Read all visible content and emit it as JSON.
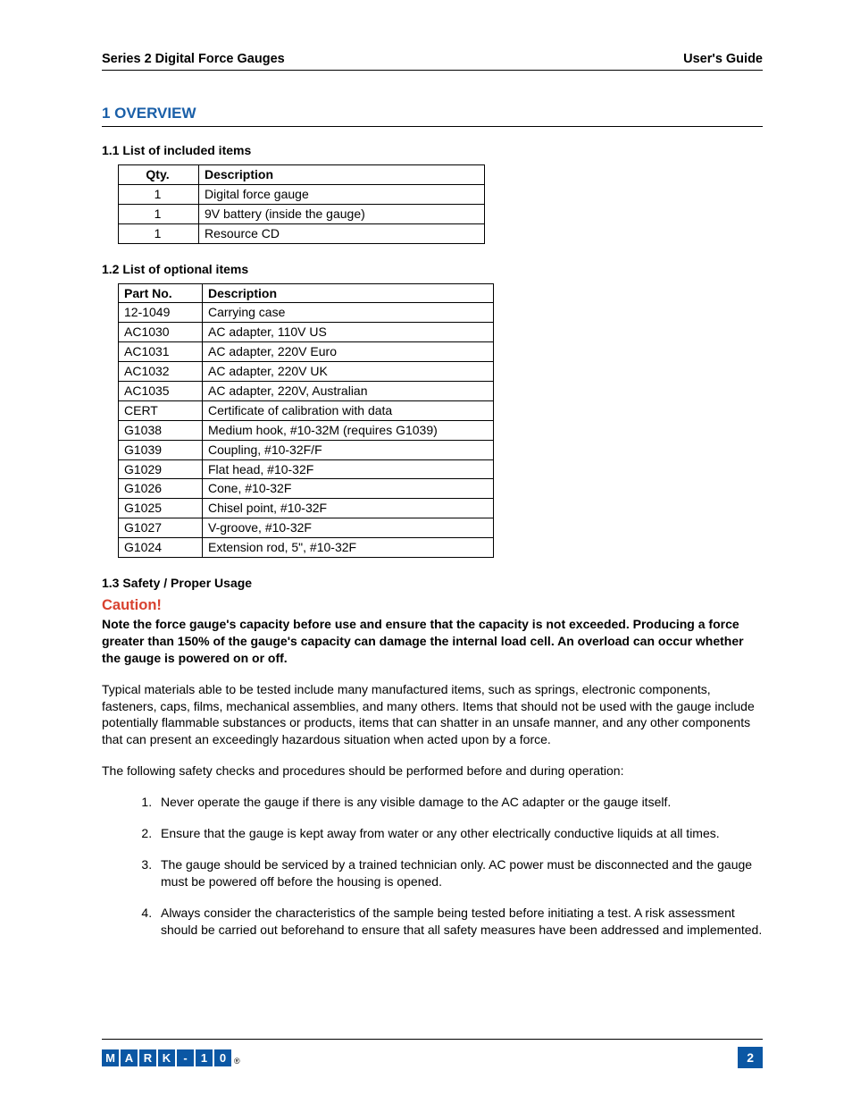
{
  "header": {
    "left": "Series 2 Digital Force Gauges",
    "right": "User's Guide"
  },
  "section": {
    "number_title": "1   OVERVIEW"
  },
  "sub11": {
    "heading": "1.1  List of included items",
    "col1": "Qty.",
    "col2": "Description",
    "rows": [
      {
        "qty": "1",
        "desc": "Digital force gauge"
      },
      {
        "qty": "1",
        "desc": "9V battery (inside the gauge)"
      },
      {
        "qty": "1",
        "desc": "Resource CD"
      }
    ]
  },
  "sub12": {
    "heading": "1.2  List of optional items",
    "col1": "Part No.",
    "col2": "Description",
    "rows": [
      {
        "part": "12-1049",
        "desc": "Carrying case"
      },
      {
        "part": "AC1030",
        "desc": "AC adapter, 110V US"
      },
      {
        "part": "AC1031",
        "desc": "AC adapter, 220V Euro"
      },
      {
        "part": "AC1032",
        "desc": "AC adapter, 220V UK"
      },
      {
        "part": "AC1035",
        "desc": "AC adapter, 220V, Australian"
      },
      {
        "part": "CERT",
        "desc": "Certificate of calibration with data"
      },
      {
        "part": "G1038",
        "desc": "Medium hook, #10-32M (requires G1039)"
      },
      {
        "part": "G1039",
        "desc": "Coupling, #10-32F/F"
      },
      {
        "part": "G1029",
        "desc": "Flat head, #10-32F"
      },
      {
        "part": "G1026",
        "desc": "Cone, #10-32F"
      },
      {
        "part": "G1025",
        "desc": "Chisel point, #10-32F"
      },
      {
        "part": "G1027",
        "desc": "V-groove, #10-32F"
      },
      {
        "part": "G1024",
        "desc": "Extension rod, 5\", #10-32F"
      }
    ]
  },
  "sub13": {
    "heading": "1.3 Safety / Proper Usage",
    "caution": "Caution!",
    "bold_note": "Note the force gauge's capacity before use and ensure that the capacity is not exceeded. Producing a force greater than 150% of the gauge's capacity can damage the internal load cell. An overload can occur whether the gauge is powered on or off.",
    "para1": "Typical materials able to be tested include many manufactured items, such as springs, electronic components, fasteners, caps, films, mechanical assemblies, and many others. Items that should not be used with the gauge include potentially flammable substances or products, items that can shatter in an unsafe manner, and any other components that can present an exceedingly hazardous situation when acted upon by a force.",
    "para2": "The following safety checks and procedures should be performed before and during operation:",
    "list": [
      "Never operate the gauge if there is any visible damage to the AC adapter or the gauge itself.",
      "Ensure that the gauge is kept away from water or any other electrically conductive liquids at all times.",
      "The gauge should be serviced by a trained technician only. AC power must be disconnected and the gauge must be powered off before the housing is opened.",
      "Always consider the characteristics of the sample being tested before initiating a test. A risk assessment should be carried out beforehand to ensure that all safety measures have been addressed and implemented."
    ]
  },
  "footer": {
    "logo_chars": [
      "M",
      "A",
      "R",
      "K",
      "-",
      "1",
      "0"
    ],
    "reg": "®",
    "page": "2"
  }
}
